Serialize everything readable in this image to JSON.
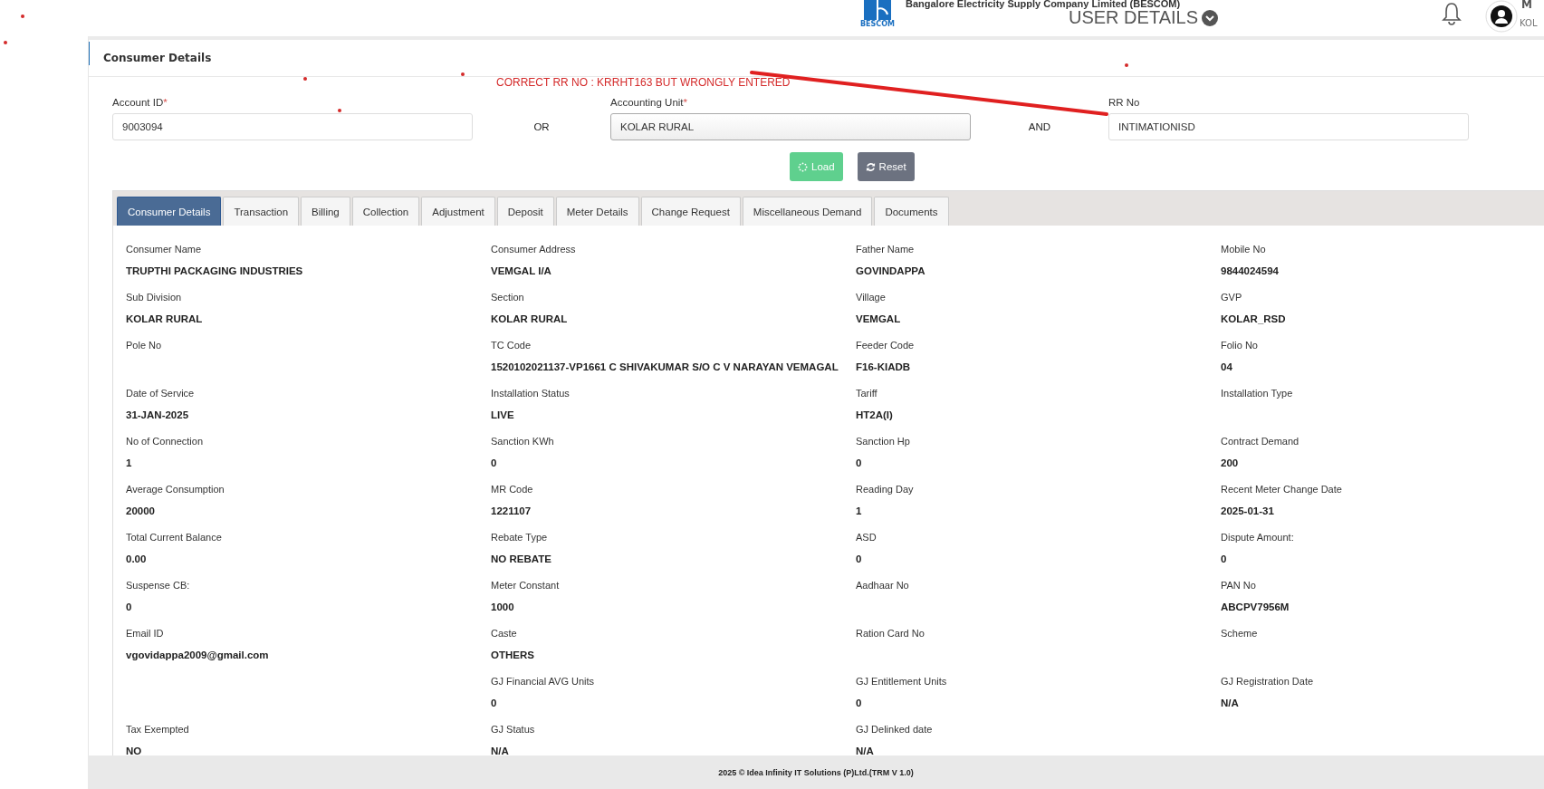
{
  "header": {
    "logo_caption": "BESCOM",
    "company": "Bangalore Electricity Supply Company Limited (BESCOM)",
    "user_menu": "USER DETAILS",
    "user_name": "M",
    "user_unit": "KOL"
  },
  "annotation": {
    "note": "CORRECT RR NO : KRRHT163 BUT WRONGLY ENTERED"
  },
  "panel": {
    "title": "Consumer Details"
  },
  "search": {
    "account_id": {
      "label": "Account ID",
      "required_mark": "*",
      "value": "9003094"
    },
    "or": "OR",
    "accounting_unit": {
      "label": "Accounting Unit",
      "required_mark": "*",
      "value": "KOLAR RURAL"
    },
    "and": "AND",
    "rr_no": {
      "label": "RR No",
      "value": "INTIMATIONISD"
    }
  },
  "buttons": [
    {
      "kind": "load",
      "label": "Load"
    },
    {
      "kind": "reset",
      "label": "Reset"
    }
  ],
  "tabs": [
    {
      "label": "Consumer Details",
      "selected": true
    },
    {
      "label": "Transaction",
      "selected": false
    },
    {
      "label": "Billing",
      "selected": false
    },
    {
      "label": "Collection",
      "selected": false
    },
    {
      "label": "Adjustment",
      "selected": false
    },
    {
      "label": "Deposit",
      "selected": false
    },
    {
      "label": "Meter Details",
      "selected": false
    },
    {
      "label": "Change Request",
      "selected": false
    },
    {
      "label": "Miscellaneous Demand",
      "selected": false
    },
    {
      "label": "Documents",
      "selected": false
    }
  ],
  "fields": [
    [
      {
        "label": "Consumer Name",
        "value": "TRUPTHI PACKAGING INDUSTRIES"
      },
      {
        "label": "Consumer Address",
        "value": "VEMGAL I/A"
      },
      {
        "label": "Father Name",
        "value": "GOVINDAPPA"
      },
      {
        "label": "Mobile No",
        "value": "9844024594"
      }
    ],
    [
      {
        "label": "Sub Division",
        "value": "KOLAR RURAL"
      },
      {
        "label": "Section",
        "value": "KOLAR RURAL"
      },
      {
        "label": "Village",
        "value": "VEMGAL"
      },
      {
        "label": "GVP",
        "value": "KOLAR_RSD"
      }
    ],
    [
      {
        "label": "Pole No"
      },
      {
        "label": "TC Code",
        "value": "1520102021137-VP1661 C SHIVAKUMAR S/O C V NARAYAN VEMAGAL"
      },
      {
        "label": "Feeder Code",
        "value": "F16-KIADB"
      },
      {
        "label": "Folio No",
        "value": "04"
      }
    ],
    [
      {
        "label": "Date of Service",
        "value": "31-JAN-2025"
      },
      {
        "label": "Installation Status",
        "value": "LIVE"
      },
      {
        "label": "Tariff",
        "value": "HT2A(I)"
      },
      {
        "label": "Installation Type"
      }
    ],
    [
      {
        "label": "No of Connection",
        "value": "1"
      },
      {
        "label": "Sanction KWh",
        "value": "0"
      },
      {
        "label": "Sanction Hp",
        "value": "0"
      },
      {
        "label": "Contract Demand",
        "value": "200"
      }
    ],
    [
      {
        "label": "Average Consumption",
        "value": "20000"
      },
      {
        "label": "MR Code",
        "value": "1221107"
      },
      {
        "label": "Reading Day",
        "value": "1"
      },
      {
        "label": "Recent Meter Change Date",
        "value": "2025-01-31"
      }
    ],
    [
      {
        "label": "Total Current Balance",
        "value": "0.00"
      },
      {
        "label": "Rebate Type",
        "value": "NO REBATE"
      },
      {
        "label": "ASD",
        "value": "0"
      },
      {
        "label": "Dispute Amount:",
        "value": "0"
      }
    ],
    [
      {
        "label": "Suspense CB:",
        "value": "0"
      },
      {
        "label": "Meter Constant",
        "value": "1000"
      },
      {
        "label": "Aadhaar No"
      },
      {
        "label": "PAN No",
        "value": "ABCPV7956M"
      }
    ],
    [
      {
        "label": "Email ID",
        "value": "vgovidappa2009@gmail.com"
      },
      {
        "label": "Caste",
        "value": "OTHERS"
      },
      {
        "label": "Ration Card No"
      },
      {
        "label": "Scheme"
      }
    ],
    [
      {
        "label": "GJ Financial AVG Units",
        "value": "0",
        "blank_before": true
      },
      {
        "label": "GJ Entitlement Units",
        "value": "0"
      },
      {
        "label": "GJ Registration Date",
        "value": "N/A"
      }
    ],
    [
      {
        "label": "Tax Exempted",
        "value": "NO"
      },
      {
        "label": "GJ Status",
        "value": "N/A"
      },
      {
        "label": "GJ Delinked date",
        "value": "N/A"
      }
    ]
  ],
  "footer": "2025 © Idea Infinity IT Solutions (P)Ltd.(TRM V 1.0)"
}
